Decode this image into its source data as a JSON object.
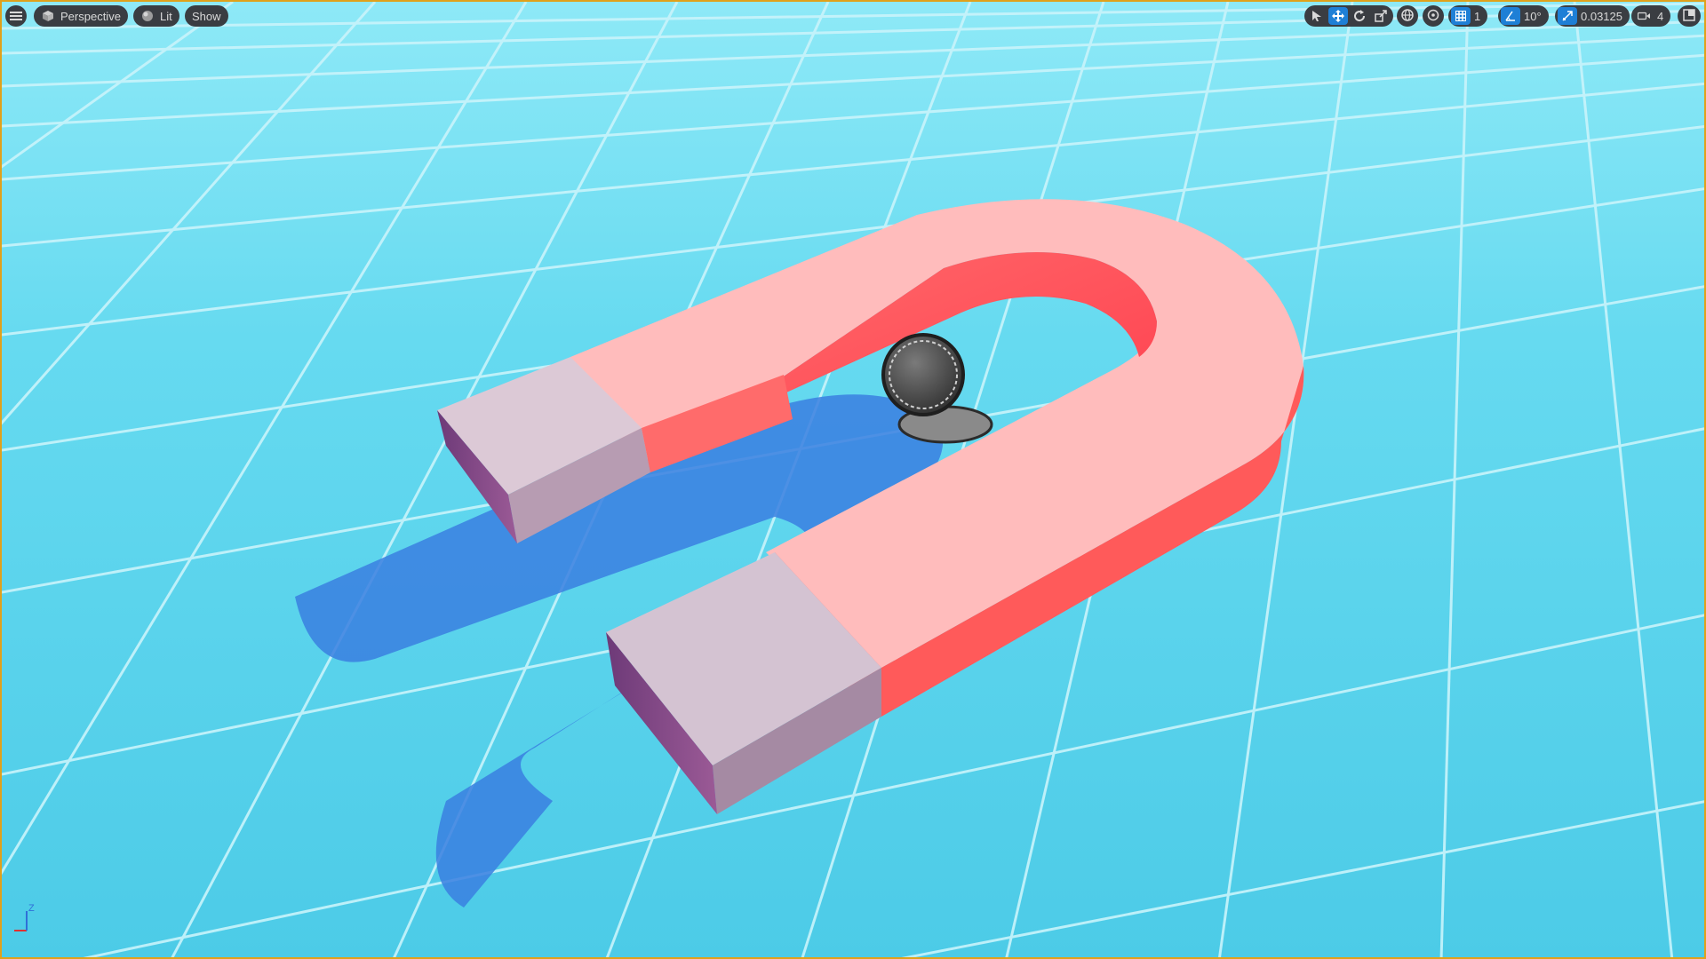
{
  "toolbar_left": {
    "menu_icon": "hamburger-menu-icon",
    "view_mode": {
      "label": "Perspective",
      "icon": "cube-icon"
    },
    "lighting_mode": {
      "label": "Lit",
      "icon": "sphere-icon"
    },
    "show_label": "Show"
  },
  "toolbar_right": {
    "transform_tools": [
      "select-icon",
      "translate-icon",
      "rotate-icon",
      "scale-icon"
    ],
    "active_tool": "translate-icon",
    "coordinate_space_icon": "globe-icon",
    "surface_snap_icon": "surface-snap-icon",
    "grid_snap": {
      "icon": "grid-icon",
      "value": "1"
    },
    "rotation_snap": {
      "icon": "angle-icon",
      "value": "10°"
    },
    "scale_snap": {
      "icon": "scale-snap-icon",
      "value": "0.03125"
    },
    "camera_speed": {
      "icon": "camera-icon",
      "value": "4"
    },
    "maximize_icon": "maximize-viewport-icon"
  },
  "scene": {
    "objects": [
      "horseshoe-magnet",
      "metal-ball",
      "floor-grid"
    ],
    "colors": {
      "sky": "#7ee6f6",
      "floor": "#49cfea",
      "grid_lines": "#c8f3fb",
      "magnet_top": "#ffb8b8",
      "magnet_side": "#ff5a5a",
      "pole_top": "#d8c8d4",
      "pole_side": "#8c4a8e",
      "shadow": "#3a7fe0",
      "ball": "#555555",
      "accent": "#1e7fd6",
      "frame": "#e0a11b"
    }
  },
  "axis_indicator": {
    "x_label": "",
    "z_label": "Z"
  }
}
